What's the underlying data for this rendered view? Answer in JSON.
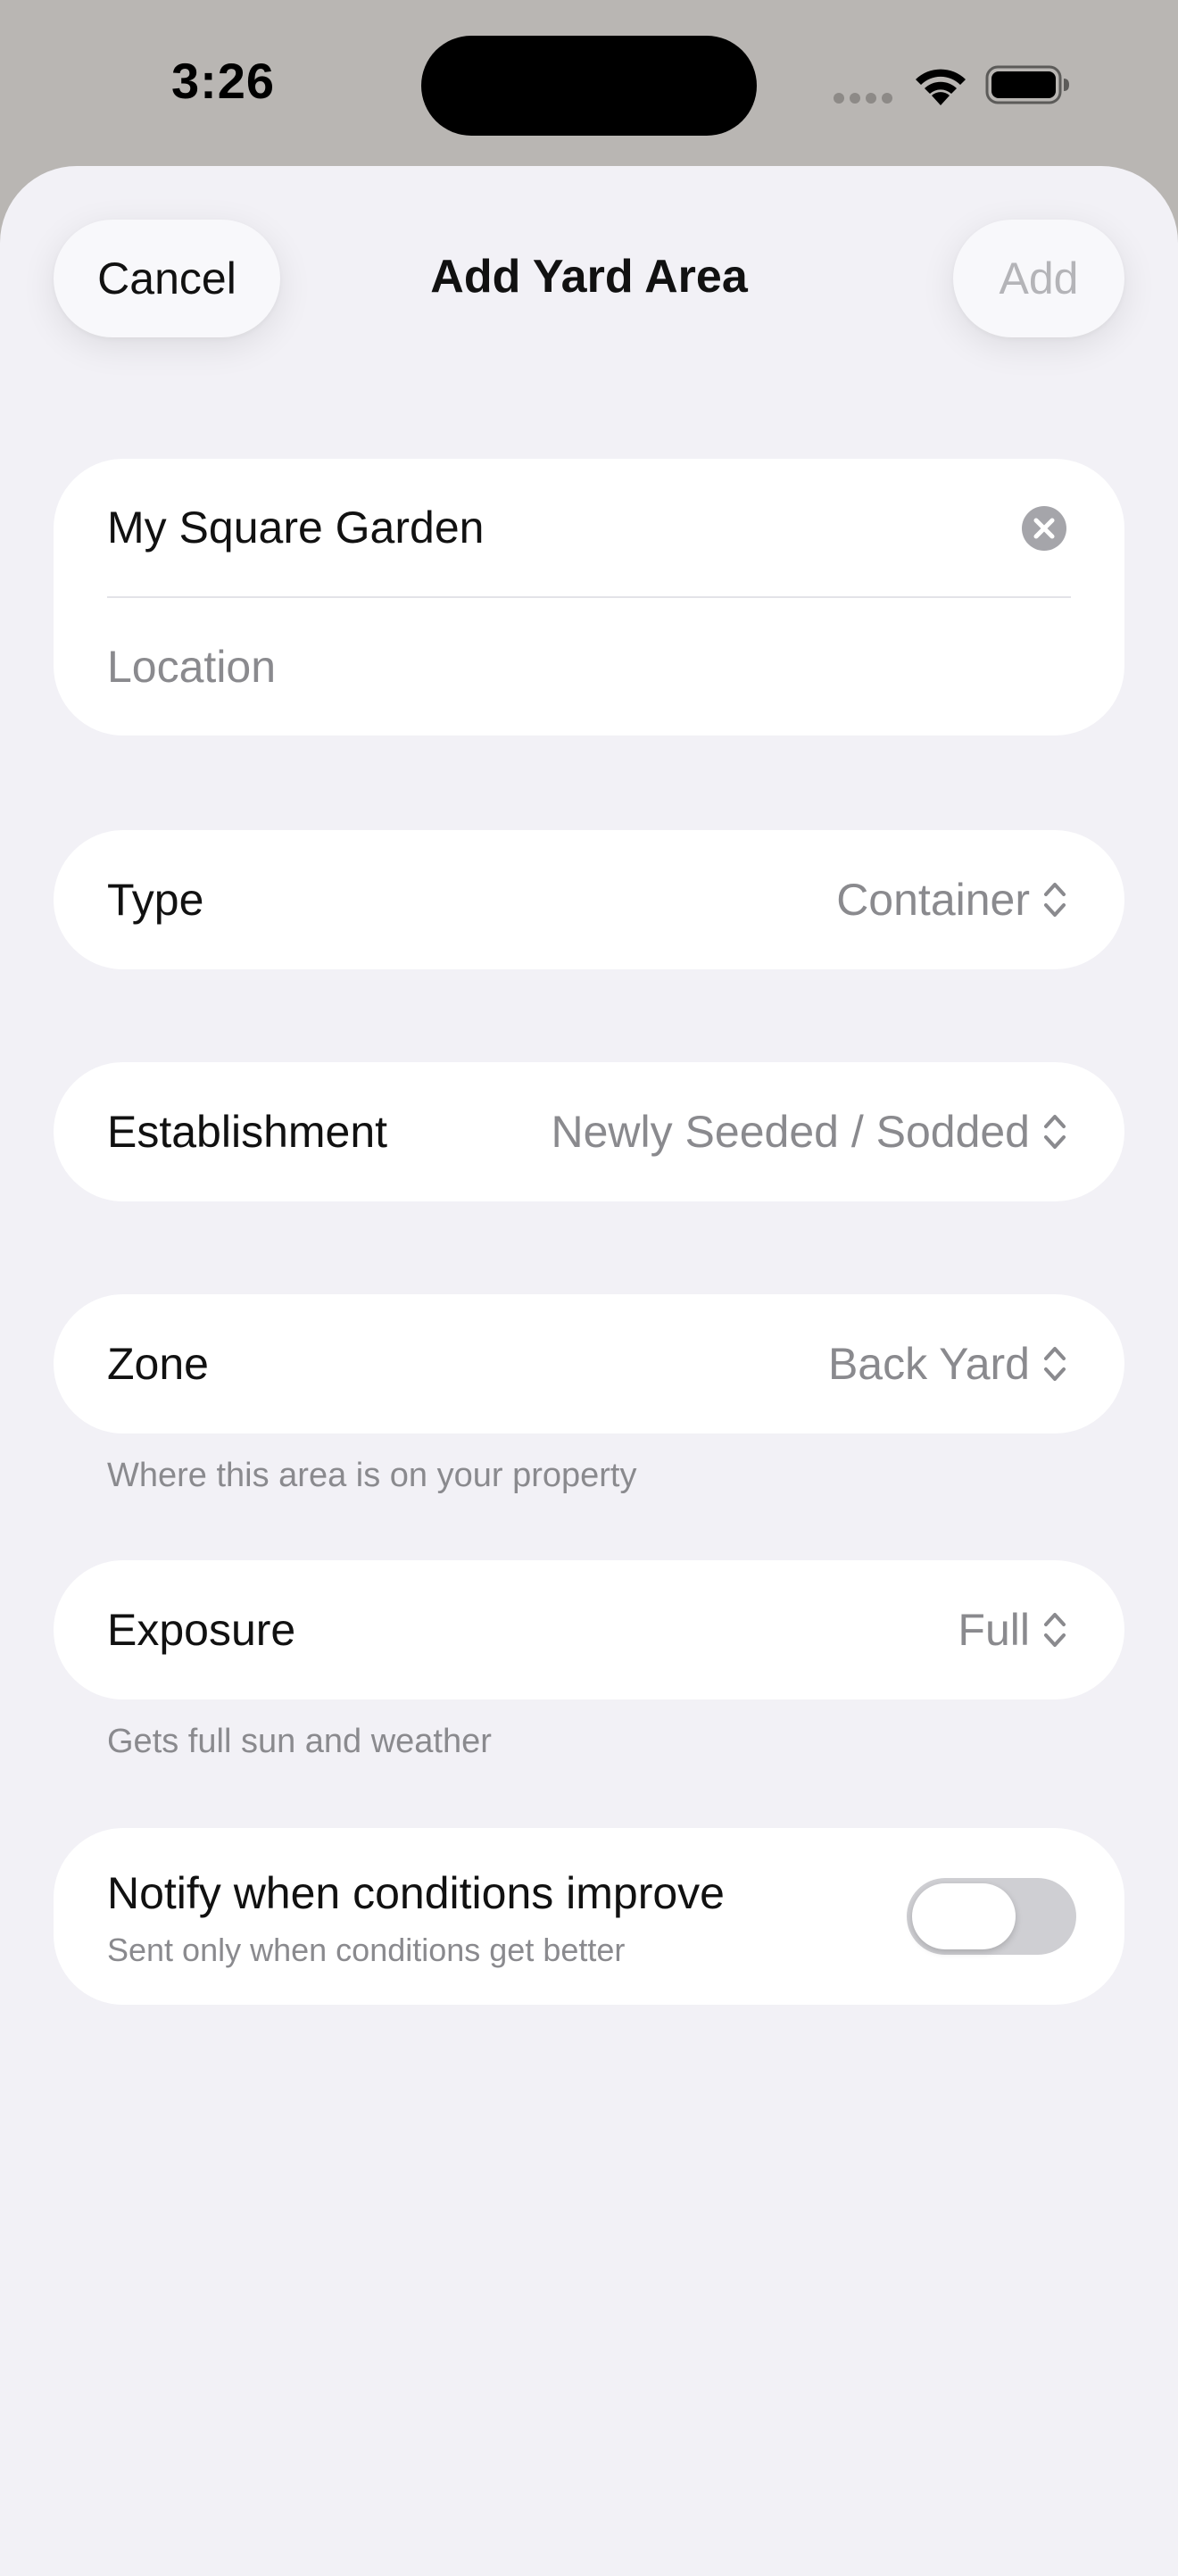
{
  "status_bar": {
    "time": "3:26"
  },
  "nav": {
    "cancel_label": "Cancel",
    "title": "Add Yard Area",
    "add_label": "Add"
  },
  "form": {
    "name_value": "My Square Garden",
    "location_placeholder": "Location",
    "type": {
      "label": "Type",
      "value": "Container"
    },
    "establishment": {
      "label": "Establishment",
      "value": "Newly Seeded / Sodded"
    },
    "zone": {
      "label": "Zone",
      "value": "Back Yard",
      "note": "Where this area is on your property"
    },
    "exposure": {
      "label": "Exposure",
      "value": "Full",
      "note": "Gets full sun and weather"
    },
    "notify": {
      "title": "Notify when conditions improve",
      "subtitle": "Sent only when conditions get better",
      "enabled": false
    }
  },
  "icons": {
    "clear": "xmark-circle-icon",
    "picker": "chevron-up-down-icon",
    "wifi": "wifi-icon",
    "battery": "battery-icon"
  },
  "colors": {
    "background": "#f2f1f6",
    "card": "#ffffff",
    "secondary_text": "#8a8a8e",
    "disabled_text": "#b4b4b8"
  }
}
